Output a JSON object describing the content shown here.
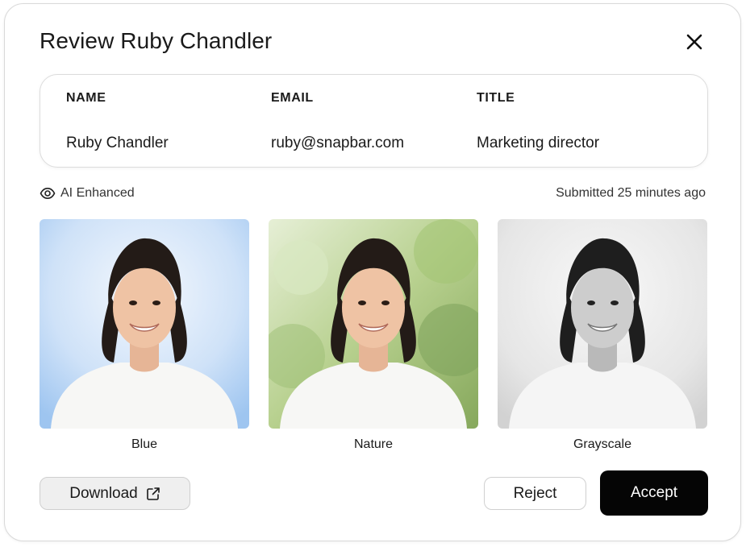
{
  "dialog": {
    "title": "Review Ruby Chandler",
    "close_icon": "close-icon"
  },
  "info": {
    "columns": [
      {
        "header": "NAME",
        "value": "Ruby Chandler"
      },
      {
        "header": "EMAIL",
        "value": "ruby@snapbar.com"
      },
      {
        "header": "TITLE",
        "value": "Marketing director"
      }
    ]
  },
  "meta": {
    "ai_icon": "eye-icon",
    "ai_label": "AI Enhanced",
    "submitted": "Submitted 25 minutes ago"
  },
  "photos": [
    {
      "caption": "Blue",
      "bg_top": "#d6e8fb",
      "bg_bottom": "#a9cdf3"
    },
    {
      "caption": "Nature",
      "bg_top": "#c9dbb0",
      "bg_bottom": "#8fb26a"
    },
    {
      "caption": "Grayscale",
      "bg_top": "#f2f2f2",
      "bg_bottom": "#d8d8d8"
    }
  ],
  "actions": {
    "download_label": "Download",
    "download_icon": "external-link-icon",
    "reject_label": "Reject",
    "accept_label": "Accept"
  },
  "colors": {
    "accept_bg": "#050505",
    "download_bg": "#efefef",
    "border": "#d9d9d9"
  }
}
